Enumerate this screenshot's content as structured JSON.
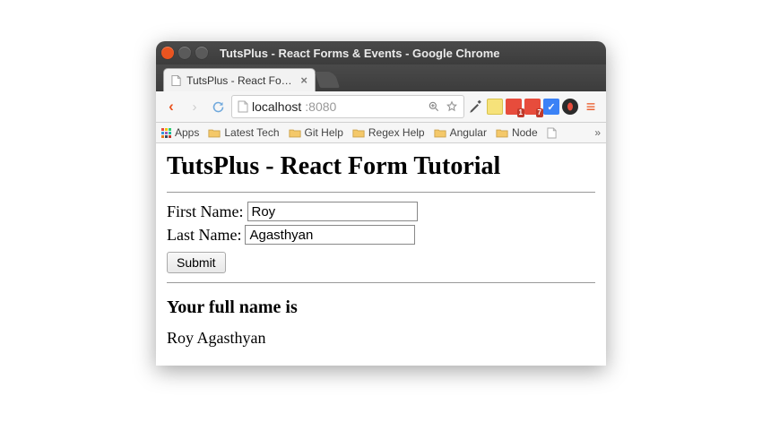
{
  "titlebar": {
    "title": "TutsPlus - React Forms & Events - Google Chrome"
  },
  "tab": {
    "title": "TutsPlus - React Form…",
    "close": "×"
  },
  "address": {
    "host": "localhost",
    "port": ":8080"
  },
  "extensions": {
    "badge1": "1",
    "badge2": "7",
    "check": "✓"
  },
  "bookmarks_bar": {
    "apps": "Apps",
    "items": [
      "Latest Tech",
      "Git Help",
      "Regex Help",
      "Angular",
      "Node"
    ],
    "more": "»"
  },
  "page": {
    "heading": "TutsPlus - React Form Tutorial",
    "first_label": "First Name:",
    "first_value": "Roy",
    "last_label": "Last Name:",
    "last_value": "Agasthyan",
    "submit": "Submit",
    "subheading": "Your full name is",
    "fullname": "Roy Agasthyan"
  }
}
